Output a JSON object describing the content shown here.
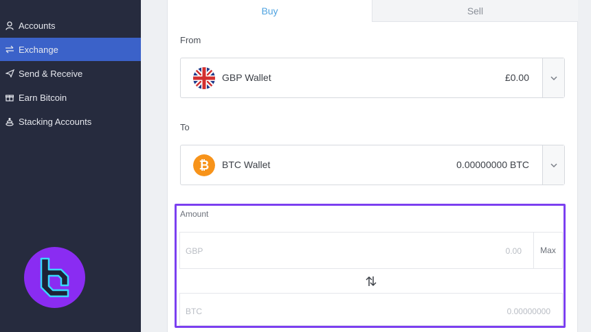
{
  "sidebar": {
    "items": [
      {
        "label": "Accounts",
        "icon": "person-icon"
      },
      {
        "label": "Exchange",
        "icon": "exchange-icon"
      },
      {
        "label": "Send & Receive",
        "icon": "paper-plane-icon"
      },
      {
        "label": "Earn Bitcoin",
        "icon": "gift-icon"
      },
      {
        "label": "Stacking Accounts",
        "icon": "coins-stack-icon"
      }
    ],
    "active": "Exchange",
    "active_color": "#3b62c9"
  },
  "tabs": {
    "buy": "Buy",
    "sell": "Sell",
    "active": "Buy",
    "accent": "#4fa3e0"
  },
  "from": {
    "label": "From",
    "wallet_name": "GBP Wallet",
    "balance": "£0.00",
    "icon": "uk-flag-icon"
  },
  "to": {
    "label": "To",
    "wallet_name": "BTC Wallet",
    "balance": "0.00000000 BTC",
    "icon": "bitcoin-icon"
  },
  "amount": {
    "label": "Amount",
    "gbp": {
      "currency": "GBP",
      "placeholder": "0.00"
    },
    "btc": {
      "currency": "BTC",
      "placeholder": "0.00000000"
    },
    "max_label": "Max",
    "highlight_color": "#7b3ff0"
  },
  "brand_color": "#8a2cf2"
}
